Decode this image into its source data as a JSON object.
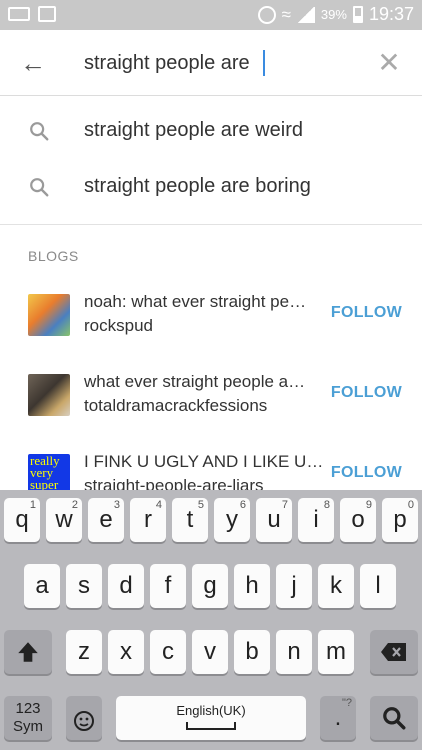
{
  "status_bar": {
    "battery_percent": "39%",
    "time": "19:37"
  },
  "search": {
    "query": "straight people are",
    "icons": {
      "back": "arrow-left-icon",
      "clear": "close-icon",
      "suggestion": "search-icon"
    }
  },
  "suggestions": [
    {
      "label": "straight people are weird"
    },
    {
      "label": "straight people are boring"
    }
  ],
  "blogs": {
    "section_label": "BLOGS",
    "follow_label": "FOLLOW",
    "accent_color": "#4b9fd5",
    "items": [
      {
        "title": "noah: what ever straight pe…",
        "name": "rockspud"
      },
      {
        "title": "what ever straight people a…",
        "name": "totaldramacrackfessions"
      },
      {
        "title": "I FINK U UGLY AND I LIKE U…",
        "name": "straight-people-are-liars",
        "avatar_text": "really very super"
      }
    ]
  },
  "keyboard": {
    "row1": [
      {
        "key": "q",
        "hint": "1"
      },
      {
        "key": "w",
        "hint": "2"
      },
      {
        "key": "e",
        "hint": "3"
      },
      {
        "key": "r",
        "hint": "4"
      },
      {
        "key": "t",
        "hint": "5"
      },
      {
        "key": "y",
        "hint": "6"
      },
      {
        "key": "u",
        "hint": "7"
      },
      {
        "key": "i",
        "hint": "8"
      },
      {
        "key": "o",
        "hint": "9"
      },
      {
        "key": "p",
        "hint": "0"
      }
    ],
    "row2": [
      "a",
      "s",
      "d",
      "f",
      "g",
      "h",
      "j",
      "k",
      "l"
    ],
    "row3": [
      "z",
      "x",
      "c",
      "v",
      "b",
      "n",
      "m"
    ],
    "sym_label_1": "123",
    "sym_label_2": "Sym",
    "space_label": "English(UK)",
    "period_key": ".",
    "period_hint": "\"?",
    "icons": {
      "shift": "shift-arrow-icon",
      "backspace": "backspace-icon",
      "emoji": "emoji-mic-icon",
      "search": "search-icon"
    }
  }
}
